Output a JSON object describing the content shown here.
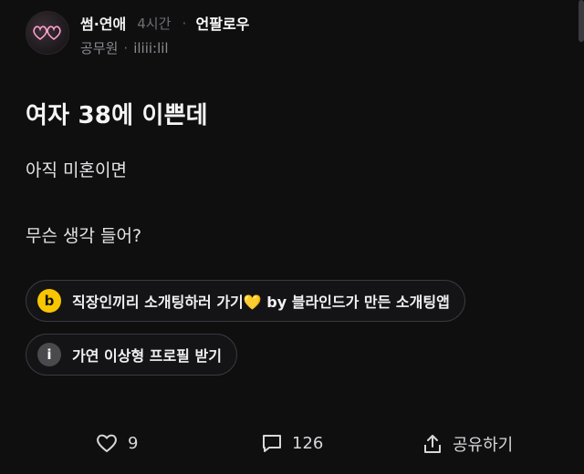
{
  "header": {
    "board": "썸·연애",
    "time": "4시간",
    "separator": "·",
    "follow_label": "언팔로우",
    "company": "공무원",
    "username": "iliii:lil"
  },
  "post": {
    "title": "여자 38에 이쁜데",
    "line1": "아직 미혼이면",
    "line2": "무슨 생각 들어?"
  },
  "promos": [
    {
      "icon_letter": "b",
      "text": "직장인끼리 소개팅하러 가기💛 by 블라인드가 만든 소개팅앱",
      "icon_color": "#f7c600"
    },
    {
      "icon_letter": "i",
      "text": "가연 이상형 프로필 받기",
      "icon_color": "#4a4a4e"
    }
  ],
  "actions": {
    "likes": "9",
    "comments": "126",
    "share_label": "공유하기"
  },
  "icons": {
    "like": "heart-icon",
    "comment": "comment-icon",
    "share": "share-icon"
  }
}
